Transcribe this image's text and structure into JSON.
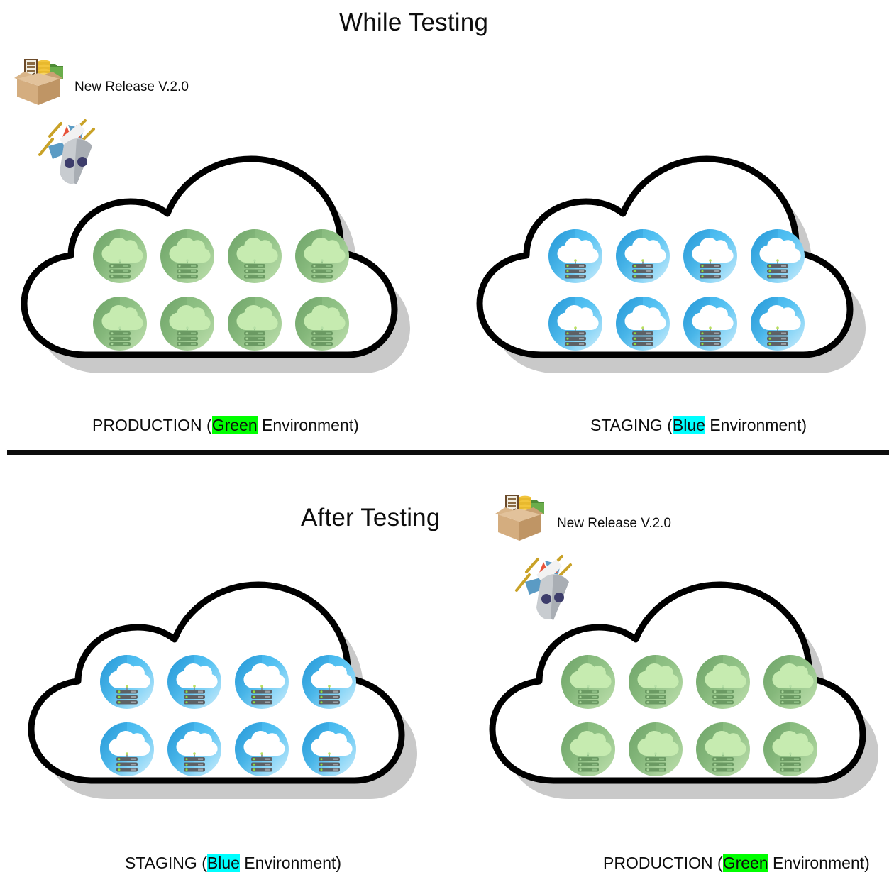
{
  "diagram": {
    "kind": "blue-green-deployment",
    "divider_color": "#0d0d0d"
  },
  "panels": {
    "top": {
      "title": "While Testing",
      "release": {
        "label": "New Release V.2.0",
        "package_icon": "package-box-icon",
        "rocket_icon": "rocket-icon"
      },
      "clouds": [
        {
          "id": "production",
          "env_name": "PRODUCTION",
          "paren_open": "(",
          "highlight": "Green",
          "suffix": " Environment)",
          "highlight_color": "#00ff00",
          "node_color": "green",
          "node_count": 8
        },
        {
          "id": "staging",
          "env_name": "STAGING",
          "paren_open": "(",
          "highlight": "Blue",
          "suffix": " Environment)",
          "highlight_color": "#00ffff",
          "node_color": "blue",
          "node_count": 8
        }
      ]
    },
    "bottom": {
      "title": "After Testing",
      "release": {
        "label": "New Release V.2.0",
        "package_icon": "package-box-icon",
        "rocket_icon": "rocket-icon"
      },
      "clouds": [
        {
          "id": "staging",
          "env_name": "STAGING",
          "paren_open": "(",
          "highlight": "Blue",
          "suffix": " Environment)",
          "highlight_color": "#00ffff",
          "node_color": "blue",
          "node_count": 8
        },
        {
          "id": "production",
          "env_name": "PRODUCTION",
          "paren_open": "(",
          "highlight": "Green",
          "suffix": " Environment)",
          "highlight_color": "#00ff00",
          "node_color": "green",
          "node_count": 8
        }
      ]
    }
  }
}
